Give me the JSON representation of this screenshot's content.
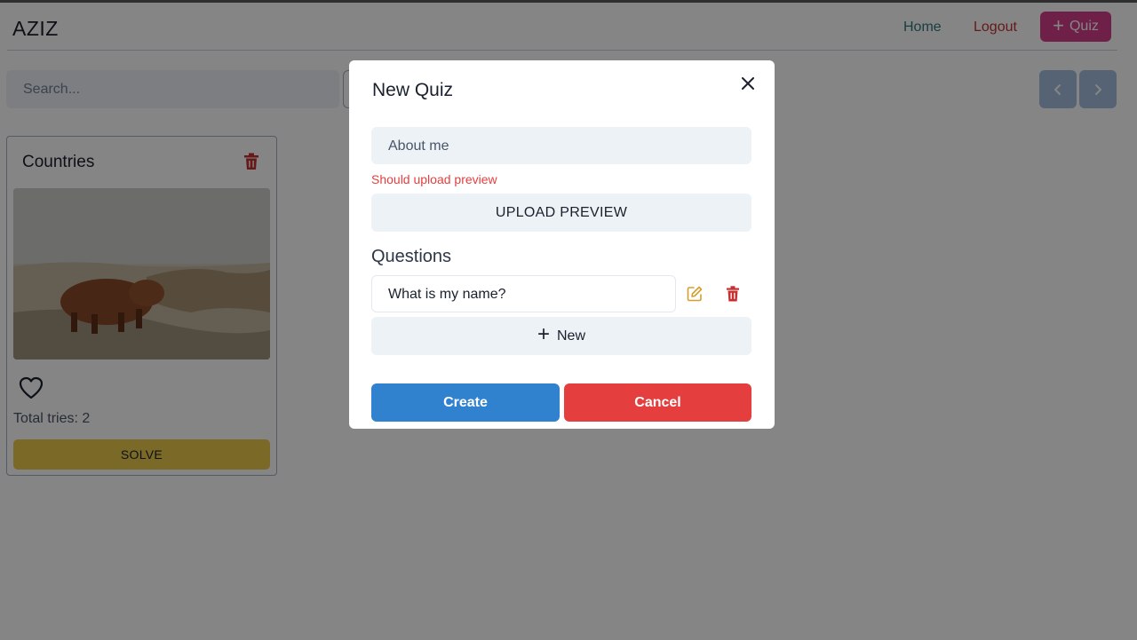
{
  "header": {
    "brand": "AZIZ",
    "nav": {
      "home": "Home",
      "logout": "Logout"
    },
    "quiz_button": {
      "icon": "plus-icon",
      "label": "Quiz"
    }
  },
  "toolbar": {
    "search_placeholder": "Search...",
    "pager": {
      "prev_icon": "chevron-left-icon",
      "next_icon": "chevron-right-icon"
    }
  },
  "cards": [
    {
      "title": "Countries",
      "image": "highland-cattle-photo",
      "tries_text": "Total tries: 2",
      "solve_label": "SOLVE"
    }
  ],
  "modal": {
    "title": "New Quiz",
    "name_value": "About me",
    "error": "Should upload preview",
    "upload_label": "UPLOAD PREVIEW",
    "questions_heading": "Questions",
    "questions": [
      {
        "text": "What is my name?"
      }
    ],
    "new_label": "New",
    "create_label": "Create",
    "cancel_label": "Cancel"
  },
  "colors": {
    "brand_pink": "#d53f8c",
    "primary": "#3182ce",
    "danger": "#e53e3e",
    "warning": "#ecc94b",
    "teal": "#2c7a7b"
  }
}
